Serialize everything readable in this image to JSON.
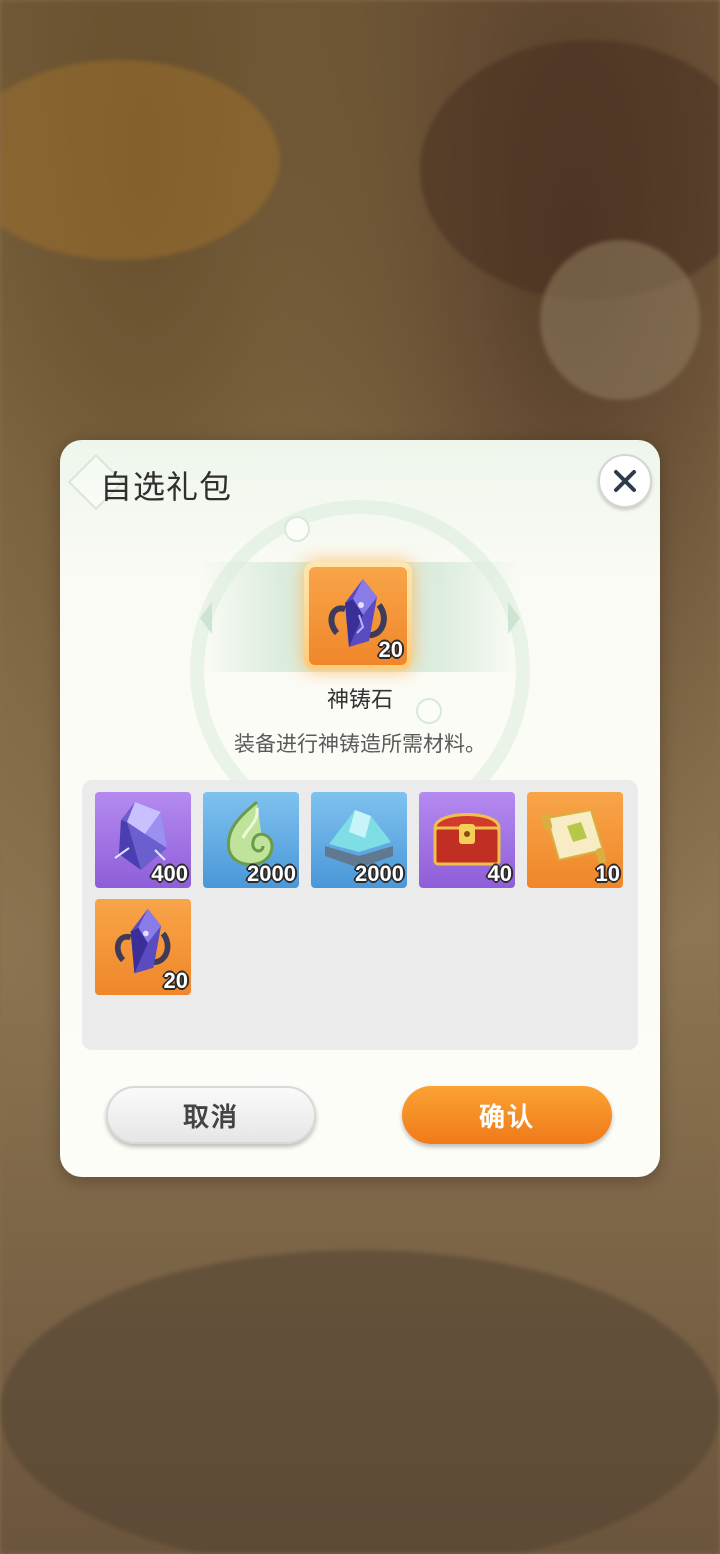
{
  "dialog": {
    "title": "自选礼包",
    "close_icon": "close-icon"
  },
  "selected_item": {
    "name": "神铸石",
    "description": "装备进行神铸造所需材料。",
    "quantity": "20",
    "icon": "crystal-stone-icon"
  },
  "items": [
    {
      "icon": "purple-crystal-icon",
      "quantity": "400",
      "rarity_color": "#9b6ee0"
    },
    {
      "icon": "green-spirit-icon",
      "quantity": "2000",
      "rarity_color": "#5aa5e0"
    },
    {
      "icon": "blue-ore-icon",
      "quantity": "2000",
      "rarity_color": "#5aa5e0"
    },
    {
      "icon": "red-chest-icon",
      "quantity": "40",
      "rarity_color": "#9b6ee0"
    },
    {
      "icon": "scroll-icon",
      "quantity": "10",
      "rarity_color": "#f39238"
    },
    {
      "icon": "crystal-stone-icon",
      "quantity": "20",
      "rarity_color": "#f39238"
    }
  ],
  "buttons": {
    "cancel_label": "取消",
    "confirm_label": "确认"
  }
}
